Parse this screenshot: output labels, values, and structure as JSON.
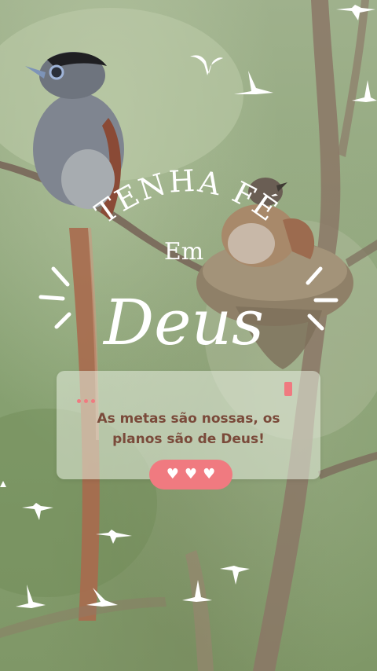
{
  "headline": {
    "arc_text": "TENHA FÉ",
    "small_word": "Em",
    "big_word": "Deus"
  },
  "card": {
    "line1": "As metas são nossas, os",
    "line2": "planos são de Deus!"
  },
  "reaction_pill": {
    "icon": "heart-icon",
    "hearts": [
      "♥",
      "♥",
      "♥"
    ]
  },
  "colors": {
    "accent_pink": "#f07a80",
    "card_text": "#7a4a3a",
    "headline_white": "#ffffff"
  }
}
